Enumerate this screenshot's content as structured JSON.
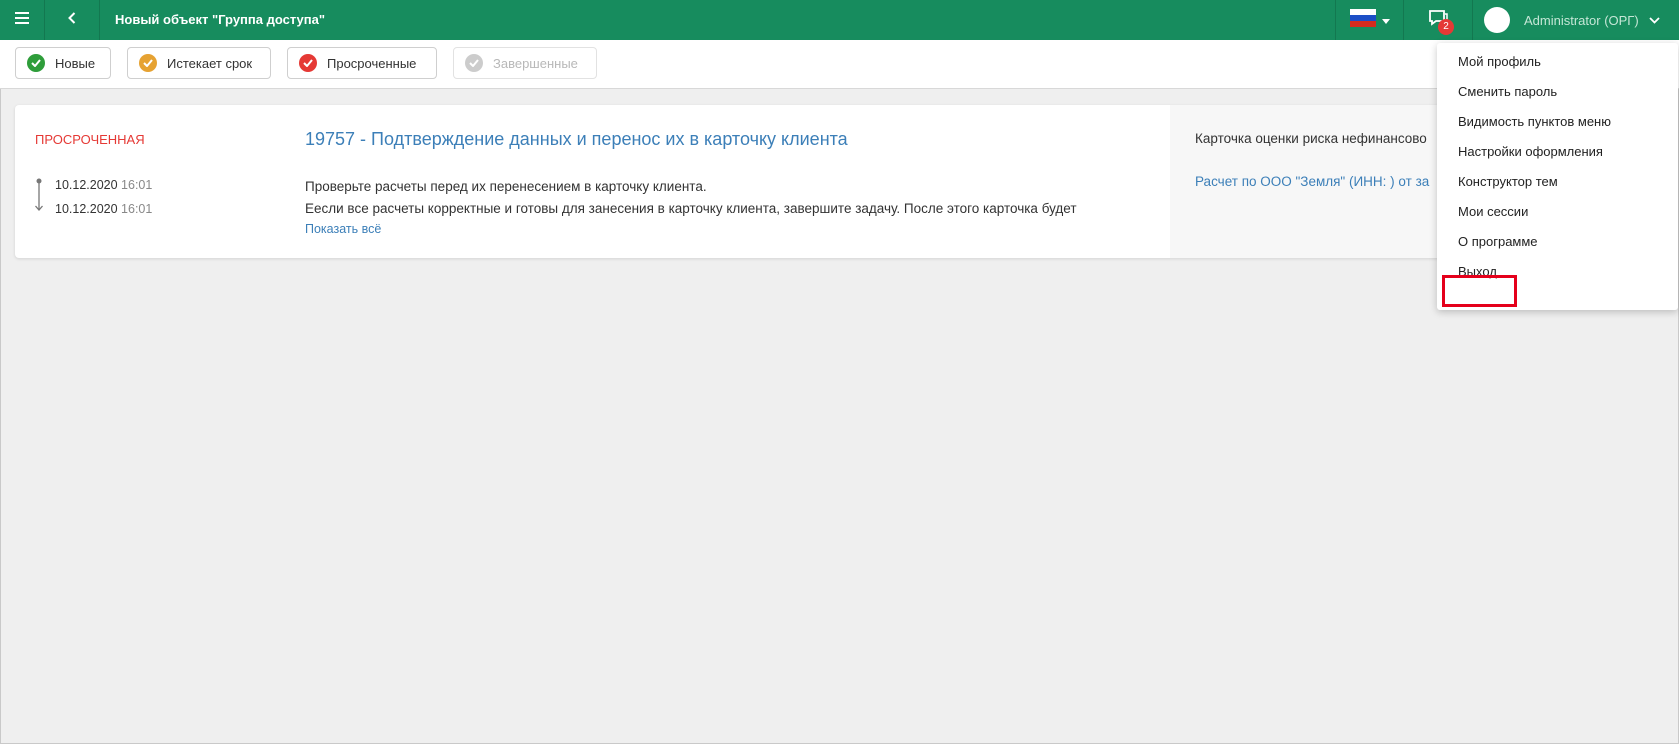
{
  "header": {
    "title": "Новый объект \"Группа доступа\"",
    "notifications_count": "2",
    "user_name": "Administrator (ОРГ)",
    "accent_color": "#178c5e"
  },
  "filters": [
    {
      "label": "Новые",
      "color": "#2e9d3a",
      "icon": "check-circle-icon"
    },
    {
      "label": "Истекает срок",
      "color": "#e6a232",
      "icon": "check-circle-icon"
    },
    {
      "label": "Просроченные",
      "color": "#e53935",
      "icon": "check-circle-icon"
    },
    {
      "label": "Завершенные",
      "color": "#cccccc",
      "icon": "check-circle-icon"
    }
  ],
  "task": {
    "status": "ПРОСРОЧЕННАЯ",
    "start_date": "10.12.2020",
    "start_time": "16:01",
    "end_date": "10.12.2020",
    "end_time": "16:01",
    "title": "19757 - Подтверждение данных и перенос их в карточку клиента",
    "description_1": "Проверьте расчеты перед их перенесением в карточку клиента.",
    "description_2": "Еесли все расчеты корректные и готовы для занесения в карточку клиента, завершите задачу. После этого карточка будет",
    "show_all": "Показать всё",
    "related_title": "Карточка оценки риска нефинансово",
    "related_link": "Расчет по ООО \"Земля\" (ИНН: ) от за"
  },
  "user_menu": {
    "items": [
      "Мой профиль",
      "Сменить пароль",
      "Видимость пунктов меню",
      "Настройки оформления",
      "Конструктор тем",
      "Мои сессии",
      "О программе",
      "Выход"
    ],
    "highlighted": "Выход"
  }
}
